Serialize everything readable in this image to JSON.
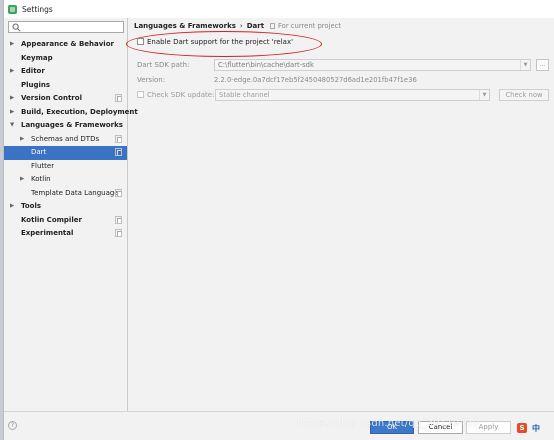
{
  "window": {
    "title": "Settings",
    "icon": "android-studio-icon"
  },
  "search": {
    "value": "",
    "placeholder": ""
  },
  "sidebar": {
    "items": [
      {
        "label": "Appearance & Behavior",
        "arrow": "▶",
        "bold": true
      },
      {
        "label": "Keymap",
        "arrow": "",
        "bold": true
      },
      {
        "label": "Editor",
        "arrow": "▶",
        "bold": true
      },
      {
        "label": "Plugins",
        "arrow": "",
        "bold": true
      },
      {
        "label": "Version Control",
        "arrow": "▶",
        "bold": true,
        "copy": true
      },
      {
        "label": "Build, Execution, Deployment",
        "arrow": "▶",
        "bold": true
      },
      {
        "label": "Languages & Frameworks",
        "arrow": "▼",
        "bold": true
      },
      {
        "label": "Schemas and DTDs",
        "arrow": "▶",
        "bold": false,
        "copy": true
      },
      {
        "label": "Dart",
        "arrow": "",
        "bold": false,
        "copy": true,
        "selected": true
      },
      {
        "label": "Flutter",
        "arrow": "",
        "bold": false
      },
      {
        "label": "Kotlin",
        "arrow": "▶",
        "bold": false
      },
      {
        "label": "Template Data Languages",
        "arrow": "",
        "bold": false,
        "copy": true
      },
      {
        "label": "Tools",
        "arrow": "▶",
        "bold": true
      },
      {
        "label": "Kotlin Compiler",
        "arrow": "",
        "bold": true,
        "copy": true
      },
      {
        "label": "Experimental",
        "arrow": "",
        "bold": true,
        "copy": true
      }
    ]
  },
  "breadcrumb": {
    "parent": "Languages & Frameworks",
    "separator": "›",
    "current": "Dart"
  },
  "scope": {
    "label": "For current project"
  },
  "dart": {
    "enable_label": "Enable Dart support for the project 'relax'",
    "sdk_path_label": "Dart SDK path:",
    "sdk_path_value": "C:\\flutter\\bin\\cache\\dart-sdk",
    "browse_label": "...",
    "version_label": "Version:",
    "version_value": "2.2.0-edge.0a7dcf17eb5f2450480527d6ad1e201fb47f1e36",
    "check_sdk_label": "Check SDK update:",
    "channel_value": "Stable channel",
    "check_now_label": "Check now"
  },
  "footer": {
    "help_label": "?",
    "ok_label": "OK",
    "cancel_label": "Cancel",
    "apply_label": "Apply"
  },
  "overlay": {
    "watermark": "https://blog.csdn.net/qq_39119430",
    "ime_s_label": "S",
    "ime_zh_label": "中"
  },
  "colors": {
    "selection": "#3a72c4",
    "annotation": "#d32020",
    "primary_button": "#3d78c9"
  }
}
